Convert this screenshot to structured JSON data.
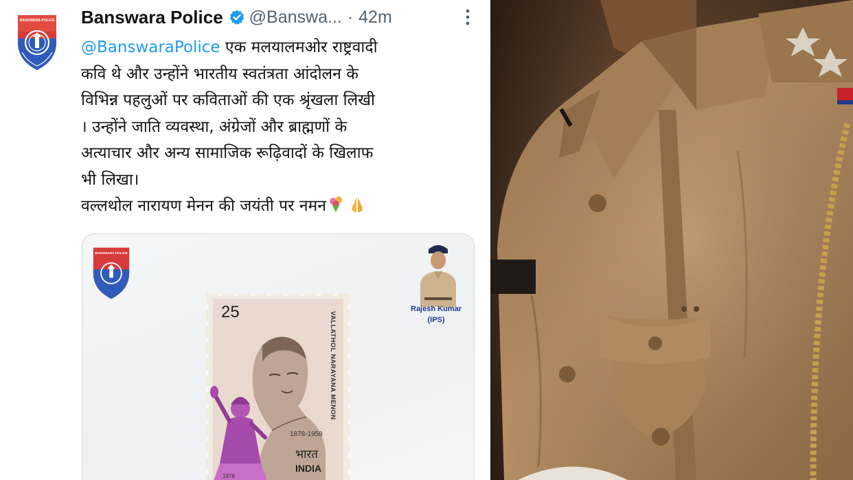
{
  "tweet": {
    "display_name": "Banswara Police",
    "handle": "@Banswa...",
    "separator": "·",
    "time": "42m",
    "verified_icon": "verified-badge-icon",
    "more_icon": "more-options-icon",
    "avatar_icon": "banswara-police-logo-icon",
    "avatar_logo_text": "BANSWARA POLICE",
    "body": {
      "mention": "@BanswaraPolice",
      "line1_rest": " एक मलयालमओर राष्ट्रवादी",
      "line2": "कवि थे और उन्होंने भारतीय स्वतंत्रता आंदोलन के",
      "line3": "विभिन्न पहलुओं पर कविताओं की एक श्रृंखला लिखी",
      "line4": "। उन्होंने जाति व्यवस्था, अंग्रेजों और ब्राह्मणों के",
      "line5": "अत्याचार और अन्य सामाजिक रूढ़िवादों के खिलाफ",
      "line6": "भी लिखा।",
      "line7": "वल्लथोल नारायण मेनन की जयंती पर नमन",
      "emojis": [
        "bouquet-emoji",
        "folded-hands-emoji"
      ]
    },
    "media": {
      "logo_text": "BANSWARA POLICE",
      "officer_name": "Rajesh Kumar",
      "officer_rank": "(IPS)",
      "stamp": {
        "value": "25",
        "years": "1878-1958",
        "side_text": "VALLATHOL NARAYANA MENON",
        "bharat": "भारत",
        "country": "INDIA",
        "issue_year": "1978"
      }
    }
  },
  "photo": {
    "subject": "police-uniform-photo",
    "colors": {
      "khaki": "#b08a63",
      "khaki_dark": "#7a5a3c",
      "background": "#2a1d14"
    }
  },
  "colors": {
    "accent": "#1d9bf0",
    "text": "#0f1419",
    "muted": "#536471",
    "border": "#cfd9de"
  }
}
